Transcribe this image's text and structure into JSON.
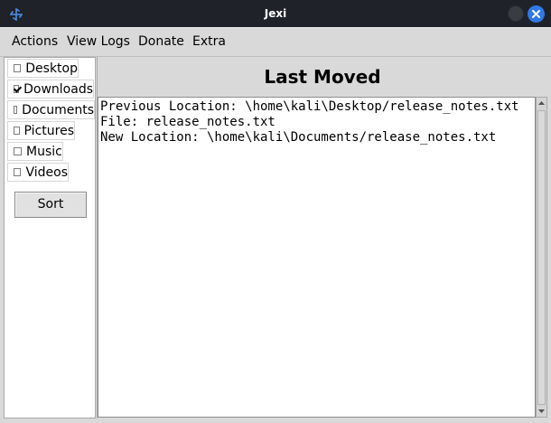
{
  "window": {
    "title": "Jexi"
  },
  "menubar": {
    "items": [
      "Actions",
      "View Logs",
      "Donate",
      "Extra"
    ]
  },
  "sidebar": {
    "folders": [
      {
        "label": "Desktop",
        "checked": false
      },
      {
        "label": "Downloads",
        "checked": true
      },
      {
        "label": "Documents",
        "checked": false
      },
      {
        "label": "Pictures",
        "checked": false
      },
      {
        "label": "Music",
        "checked": false
      },
      {
        "label": "Videos",
        "checked": false
      }
    ],
    "sort_label": "Sort"
  },
  "main": {
    "title": "Last Moved",
    "log_lines": [
      "Previous Location: \\home\\kali\\Desktop/release_notes.txt",
      "File: release_notes.txt",
      "New Location: \\home\\kali\\Documents/release_notes.txt"
    ]
  },
  "colors": {
    "titlebar_bg": "#20222a",
    "window_bg": "#d9d9d9",
    "close_button": "#2f7ae5"
  },
  "icons": {
    "app": "pinwheel-icon",
    "minimize": "minimize-icon",
    "close": "close-icon"
  }
}
